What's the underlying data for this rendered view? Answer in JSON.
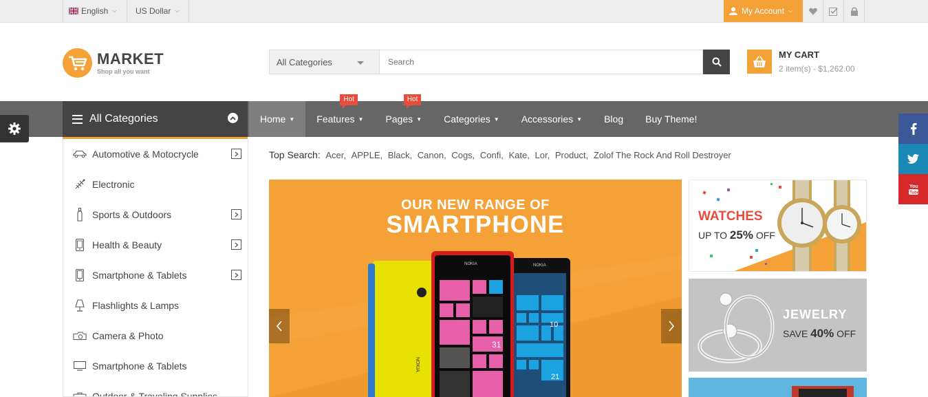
{
  "topbar": {
    "language": "English",
    "currency": "US Dollar",
    "account": "My Account"
  },
  "logo": {
    "title": "MARKET",
    "tagline": "Shop all you want"
  },
  "search": {
    "category": "All Categories",
    "placeholder": "Search"
  },
  "cart": {
    "title": "MY CART",
    "summary": "2 item(s) - $1,262.00"
  },
  "nav": {
    "all_categories": "All Categories",
    "items": [
      {
        "label": "Home"
      },
      {
        "label": "Features",
        "badge": "Hot"
      },
      {
        "label": "Pages",
        "badge": "Hot"
      },
      {
        "label": "Categories"
      },
      {
        "label": "Accessories"
      },
      {
        "label": "Blog"
      },
      {
        "label": "Buy Theme!"
      }
    ]
  },
  "categories": [
    {
      "label": "Automotive & Motocrycle",
      "icon": "car-icon"
    },
    {
      "label": "Electronic",
      "icon": "satellite-icon"
    },
    {
      "label": "Sports & Outdoors",
      "icon": "bottle-icon"
    },
    {
      "label": "Health & Beauty",
      "icon": "phone-icon"
    },
    {
      "label": "Smartphone & Tablets",
      "icon": "tablet-icon"
    },
    {
      "label": "Flashlights & Lamps",
      "icon": "lamp-icon"
    },
    {
      "label": "Camera & Photo",
      "icon": "camera-icon"
    },
    {
      "label": "Smartphone & Tablets",
      "icon": "monitor-icon"
    },
    {
      "label": "Outdoor & Traveling Supplies",
      "icon": "bag-icon"
    }
  ],
  "top_search": {
    "label": "Top Search:",
    "keywords": [
      "Acer,",
      "APPLE,",
      "Black,",
      "Canon,",
      "Cogs,",
      "Confi,",
      "Kate,",
      "Lor,",
      "Product,",
      "Zolof The Rock And Roll Destroyer"
    ]
  },
  "slider": {
    "subtitle": "OUR NEW RANGE OF",
    "title": "SMARTPHONE",
    "phone_brand": "NOKIA"
  },
  "side_banners": {
    "watches": {
      "title": "WATCHES",
      "prefix": "UP TO ",
      "value": "25%",
      "suffix": " OFF"
    },
    "jewelry": {
      "title": "JEWELRY",
      "prefix": "SAVE ",
      "value": "40%",
      "suffix": " OFF"
    }
  },
  "colors": {
    "accent": "#f4a137",
    "nav": "#666666",
    "dark": "#444444",
    "hot": "#e74c3c",
    "facebook": "#3b5998",
    "twitter": "#1b87b4",
    "youtube": "#d62a2a"
  }
}
